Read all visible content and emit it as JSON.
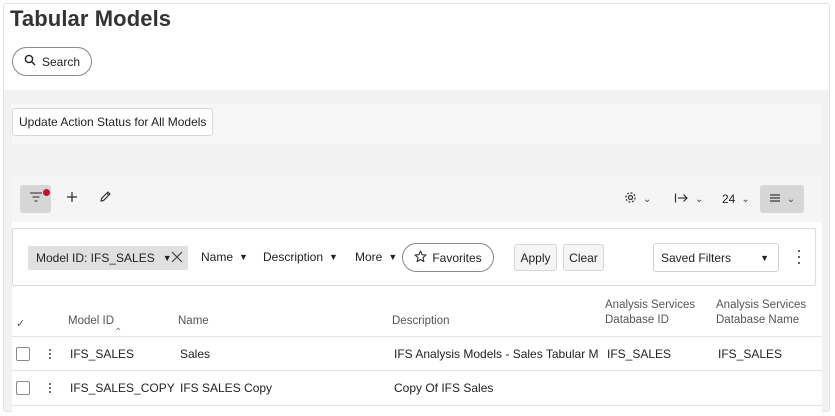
{
  "page": {
    "title": "Tabular Models"
  },
  "search": {
    "label": "Search",
    "icon": "search-icon"
  },
  "actions": {
    "update_label": "Update Action Status for All Models"
  },
  "toolbar": {
    "filter_icon": "filter-icon",
    "add_icon": "plus-icon",
    "edit_icon": "pencil-icon",
    "settings_icon": "gear-icon",
    "export_icon": "arrow-right-bar-icon",
    "page_size": "24",
    "view_icon": "list-view-icon",
    "filter_active_color": "#c8102e"
  },
  "filters": {
    "chip_label": "Model ID: IFS_SALES",
    "name_label": "Name",
    "description_label": "Description",
    "more_label": "More",
    "favorites_label": "Favorites",
    "apply_label": "Apply",
    "clear_label": "Clear",
    "saved_filters_label": "Saved Filters"
  },
  "table": {
    "columns": {
      "model_id": "Model ID",
      "name": "Name",
      "description": "Description",
      "db_id_line1": "Analysis Services",
      "db_id_line2": "Database ID",
      "db_name_line1": "Analysis Services",
      "db_name_line2": "Database Name"
    },
    "rows": [
      {
        "model_id": "IFS_SALES",
        "name": "Sales",
        "description": "IFS Analysis Models - Sales Tabular M...",
        "db_id": "IFS_SALES",
        "db_name": "IFS_SALES"
      },
      {
        "model_id": "IFS_SALES_COPY",
        "name": "IFS SALES Copy",
        "description": "Copy Of IFS Sales",
        "db_id": "",
        "db_name": ""
      }
    ]
  }
}
